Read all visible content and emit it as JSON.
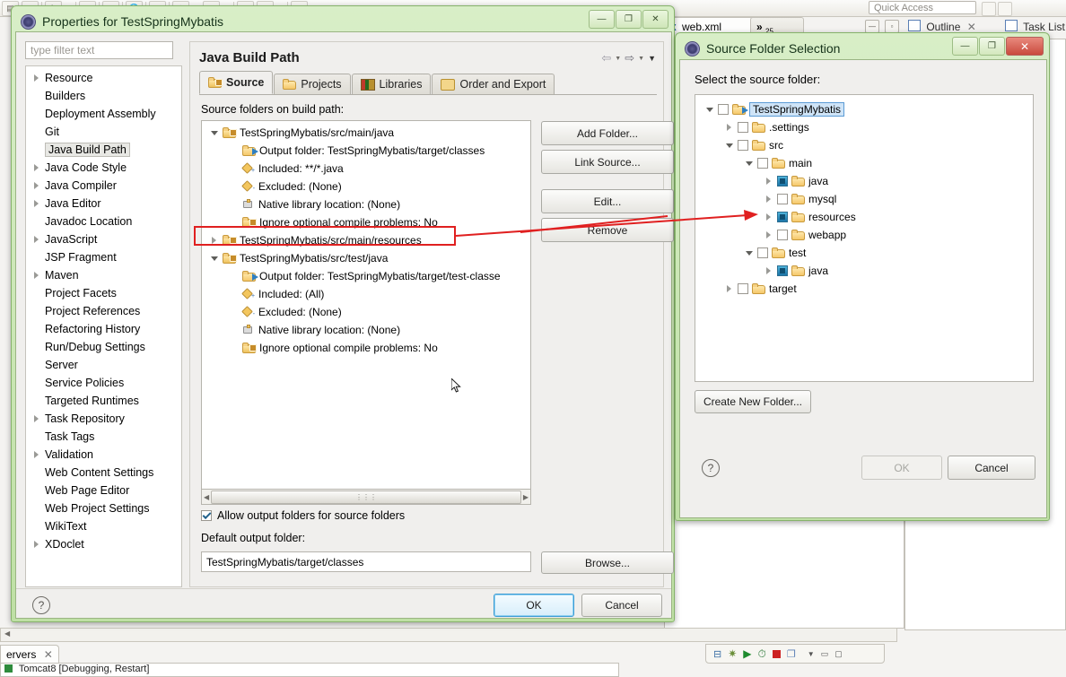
{
  "workbench": {
    "quick_access_placeholder": "Quick Access",
    "toolbar_icons": [
      "new-icon",
      "save-icon",
      "print-icon",
      "dropdown-caret",
      "console-icon",
      "table-icon",
      "globe-icon",
      "run-icon",
      "debug-icon",
      "dropdown-caret2",
      "search-icon",
      "dropdown-caret3",
      "annotation-icon",
      "annotation2-icon",
      "dropdown-caret4",
      "perspective-icon",
      "dropdown-caret5"
    ],
    "editor_tabs": [
      {
        "label": "web.xml",
        "icon": "xml-file-icon"
      },
      {
        "label": "»",
        "badge": "25",
        "icon": "overflow-icon"
      }
    ],
    "right_views": [
      {
        "label": "Outline",
        "icon": "outline-icon",
        "closable": true
      },
      {
        "label": "Task List",
        "icon": "tasklist-icon",
        "closable": false
      }
    ],
    "bottom_view_tab": {
      "label": "ervers",
      "closable": true
    },
    "bottom_view_row": "Tomcat8 [Debugging, Restart]",
    "bottom_toolbar_icons": [
      "collapse-all-icon",
      "debug-icon",
      "run-icon",
      "profile-icon",
      "stop-icon",
      "copy-icon",
      "view-menu-icon",
      "minimize-icon",
      "maximize-icon"
    ]
  },
  "properties_dialog": {
    "title": "Properties for TestSpringMybatis",
    "window_buttons": [
      "minimize-icon",
      "maximize-icon",
      "close-icon"
    ],
    "filter": {
      "placeholder": "type filter text",
      "value": ""
    },
    "tree": [
      {
        "label": "Resource",
        "expandable": true,
        "selected": false
      },
      {
        "label": "Builders",
        "expandable": false,
        "selected": false
      },
      {
        "label": "Deployment Assembly",
        "expandable": false,
        "selected": false
      },
      {
        "label": "Git",
        "expandable": false,
        "selected": false
      },
      {
        "label": "Java Build Path",
        "expandable": false,
        "selected": true
      },
      {
        "label": "Java Code Style",
        "expandable": true,
        "selected": false
      },
      {
        "label": "Java Compiler",
        "expandable": true,
        "selected": false
      },
      {
        "label": "Java Editor",
        "expandable": true,
        "selected": false
      },
      {
        "label": "Javadoc Location",
        "expandable": false,
        "selected": false
      },
      {
        "label": "JavaScript",
        "expandable": true,
        "selected": false
      },
      {
        "label": "JSP Fragment",
        "expandable": false,
        "selected": false
      },
      {
        "label": "Maven",
        "expandable": true,
        "selected": false
      },
      {
        "label": "Project Facets",
        "expandable": false,
        "selected": false
      },
      {
        "label": "Project References",
        "expandable": false,
        "selected": false
      },
      {
        "label": "Refactoring History",
        "expandable": false,
        "selected": false
      },
      {
        "label": "Run/Debug Settings",
        "expandable": false,
        "selected": false
      },
      {
        "label": "Server",
        "expandable": false,
        "selected": false
      },
      {
        "label": "Service Policies",
        "expandable": false,
        "selected": false
      },
      {
        "label": "Targeted Runtimes",
        "expandable": false,
        "selected": false
      },
      {
        "label": "Task Repository",
        "expandable": true,
        "selected": false
      },
      {
        "label": "Task Tags",
        "expandable": false,
        "selected": false
      },
      {
        "label": "Validation",
        "expandable": true,
        "selected": false
      },
      {
        "label": "Web Content Settings",
        "expandable": false,
        "selected": false
      },
      {
        "label": "Web Page Editor",
        "expandable": false,
        "selected": false
      },
      {
        "label": "Web Project Settings",
        "expandable": false,
        "selected": false
      },
      {
        "label": "WikiText",
        "expandable": false,
        "selected": false
      },
      {
        "label": "XDoclet",
        "expandable": true,
        "selected": false
      }
    ],
    "page_title": "Java Build Path",
    "nav_icons": [
      "back-arrow-icon",
      "back-dropdown-icon",
      "forward-arrow-icon",
      "forward-dropdown-icon",
      "view-menu-icon"
    ],
    "tabs": [
      {
        "label": "Source",
        "icon": "source-folder-icon",
        "active": true
      },
      {
        "label": "Projects",
        "icon": "projects-icon",
        "active": false
      },
      {
        "label": "Libraries",
        "icon": "libraries-icon",
        "active": false
      },
      {
        "label": "Order and Export",
        "icon": "order-export-icon",
        "active": false
      }
    ],
    "source_label": "Source folders on build path:",
    "source_tree": [
      {
        "label": "TestSpringMybatis/src/main/java",
        "indent": 0,
        "twisty": "open",
        "icon": "source-folder-icon",
        "highlight": false
      },
      {
        "label": "Output folder: TestSpringMybatis/target/classes",
        "indent": 1,
        "twisty": "none",
        "icon": "output-folder-icon",
        "highlight": false
      },
      {
        "label": "Included: **/*.java",
        "indent": 1,
        "twisty": "none",
        "icon": "included-icon",
        "highlight": false
      },
      {
        "label": "Excluded: (None)",
        "indent": 1,
        "twisty": "none",
        "icon": "excluded-icon",
        "highlight": false
      },
      {
        "label": "Native library location: (None)",
        "indent": 1,
        "twisty": "none",
        "icon": "native-library-icon",
        "highlight": false
      },
      {
        "label": "Ignore optional compile problems: No",
        "indent": 1,
        "twisty": "none",
        "icon": "compile-problems-icon",
        "highlight": false
      },
      {
        "label": "TestSpringMybatis/src/main/resources",
        "indent": 0,
        "twisty": "closed",
        "icon": "source-folder-icon",
        "highlight": true
      },
      {
        "label": "TestSpringMybatis/src/test/java",
        "indent": 0,
        "twisty": "open",
        "icon": "source-folder-icon",
        "highlight": false
      },
      {
        "label": "Output folder: TestSpringMybatis/target/test-classe",
        "indent": 1,
        "twisty": "none",
        "icon": "output-folder-icon",
        "highlight": false
      },
      {
        "label": "Included: (All)",
        "indent": 1,
        "twisty": "none",
        "icon": "included-icon",
        "highlight": false
      },
      {
        "label": "Excluded: (None)",
        "indent": 1,
        "twisty": "none",
        "icon": "excluded-icon",
        "highlight": false
      },
      {
        "label": "Native library location: (None)",
        "indent": 1,
        "twisty": "none",
        "icon": "native-library-icon",
        "highlight": false
      },
      {
        "label": "Ignore optional compile problems: No",
        "indent": 1,
        "twisty": "none",
        "icon": "compile-problems-icon",
        "highlight": false
      }
    ],
    "side_buttons": [
      {
        "label": "Add Folder...",
        "enabled": true
      },
      {
        "label": "Link Source...",
        "enabled": true
      },
      {
        "label": "Edit...",
        "enabled": true
      },
      {
        "label": "Remove",
        "enabled": true
      }
    ],
    "allow_output_checkbox": {
      "label": "Allow output folders for source folders",
      "checked": true
    },
    "default_output_label": "Default output folder:",
    "default_output_value": "TestSpringMybatis/target/classes",
    "browse_button": "Browse...",
    "footer": {
      "help": "?",
      "ok": "OK",
      "cancel": "Cancel",
      "ok_focused": true
    }
  },
  "source_folder_dialog": {
    "title": "Source Folder Selection",
    "window_buttons": [
      "minimize-icon",
      "maximize-icon",
      "close-icon"
    ],
    "prompt": "Select the source folder:",
    "tree": [
      {
        "label": "TestSpringMybatis",
        "depth": 0,
        "twisty": "open",
        "checked": "none",
        "selected": true,
        "arrow": false
      },
      {
        "label": ".settings",
        "depth": 1,
        "twisty": "closed",
        "checked": "none",
        "selected": false,
        "arrow": false
      },
      {
        "label": "src",
        "depth": 1,
        "twisty": "open",
        "checked": "none",
        "selected": false,
        "arrow": false
      },
      {
        "label": "main",
        "depth": 2,
        "twisty": "open",
        "checked": "none",
        "selected": false,
        "arrow": false
      },
      {
        "label": "java",
        "depth": 3,
        "twisty": "closed",
        "checked": "on",
        "selected": false,
        "arrow": false
      },
      {
        "label": "mysql",
        "depth": 3,
        "twisty": "closed",
        "checked": "none",
        "selected": false,
        "arrow": false
      },
      {
        "label": "resources",
        "depth": 3,
        "twisty": "closed",
        "checked": "on",
        "selected": false,
        "arrow": true
      },
      {
        "label": "webapp",
        "depth": 3,
        "twisty": "closed",
        "checked": "none",
        "selected": false,
        "arrow": false
      },
      {
        "label": "test",
        "depth": 2,
        "twisty": "open",
        "checked": "none",
        "selected": false,
        "arrow": false
      },
      {
        "label": "java",
        "depth": 3,
        "twisty": "closed",
        "checked": "on",
        "selected": false,
        "arrow": false
      },
      {
        "label": "target",
        "depth": 1,
        "twisty": "closed",
        "checked": "none",
        "selected": false,
        "arrow": false
      }
    ],
    "create_folder_button": "Create New Folder...",
    "footer": {
      "help": "?",
      "ok": "OK",
      "cancel": "Cancel",
      "ok_enabled": false
    }
  },
  "annotation": {
    "color": "#e02020",
    "description": "red arrow from highlighted resources row to tree item"
  }
}
